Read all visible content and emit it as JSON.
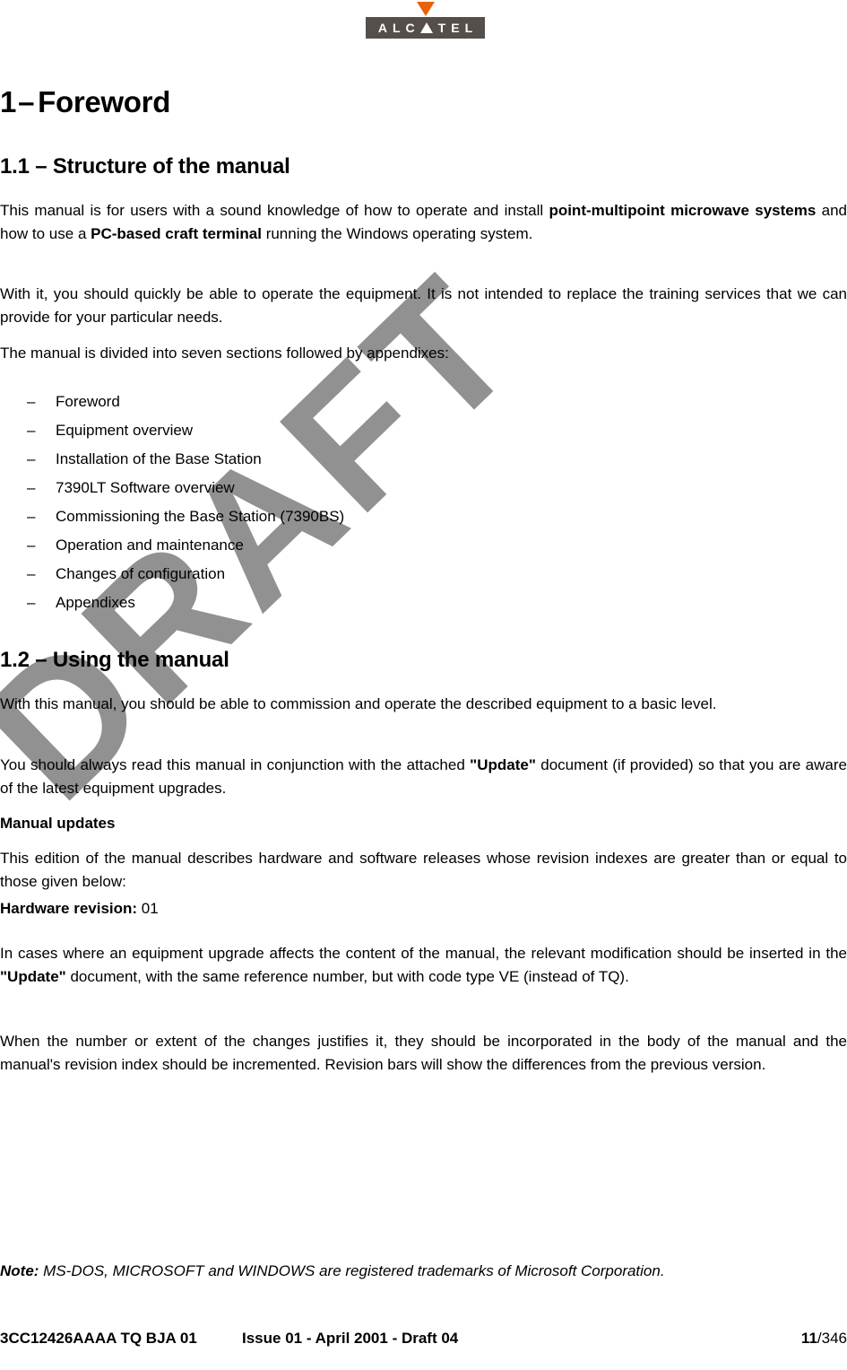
{
  "logo": {
    "name": "alcatel-logo",
    "letters": [
      "A",
      "L",
      "C",
      "A",
      "T",
      "E",
      "L"
    ],
    "box_color": "#554E4A",
    "triangle_color": "#E8620B",
    "letter_color": "#FFFFFF"
  },
  "watermark": {
    "text": "DRAFT",
    "color": "#919191"
  },
  "headings": {
    "chapter_number": "1",
    "chapter_dash": "–",
    "chapter_title": "Foreword",
    "section_1_1": "1.1 –  Structure of the manual",
    "section_1_2": "1.2 –  Using the manual",
    "subheading_manual_updates": "Manual updates"
  },
  "paragraphs": {
    "intro_part1": "This manual is for users with a sound knowledge of how to operate and install ",
    "intro_bold1": "point-multipoint microwave systems",
    "intro_part2": " and how to use a ",
    "intro_bold2": "PC-based craft terminal",
    "intro_part3": " running the Windows operating system.",
    "with_it": "With it, you should quickly be able to operate the equipment. It is not intended to replace the training services that we can provide for your particular needs.",
    "divided_into": "The manual is divided into seven sections followed by appendixes:",
    "using_manual_basic": "With this manual, you should be able to commission and operate the described equipment to a basic level.",
    "always_read_part1": "You should always read this manual in conjunction with the attached ",
    "always_read_bold": "\"Update\"",
    "always_read_part2": " document (if provided) so that you are aware of the latest equipment upgrades.",
    "this_edition": "This edition of the manual describes hardware and software releases whose revision indexes are greater than or equal to those given below:",
    "hardware_revision_label": "Hardware revision:",
    "hardware_revision_value": " 01",
    "in_cases_part1": "In cases where an equipment upgrade affects the content of the manual, the relevant modification should be inserted in the ",
    "in_cases_bold": "\"Update\"",
    "in_cases_part2": " document, with the same reference number, but with code type VE (instead of TQ).",
    "when_number": "When the number or extent of the changes justifies it, they should be incorporated in the body of the manual and the manual's revision index should be incremented. Revision bars will show the differences from the previous version.",
    "note_label": "Note:",
    "note_body": " MS-DOS, MICROSOFT and WINDOWS are registered trademarks of Microsoft Corporation."
  },
  "section_list": {
    "dash": "–",
    "items": [
      "Foreword",
      "Equipment overview",
      "Installation of the Base Station",
      "7390LT Software overview",
      "Commissioning the Base Station (7390BS)",
      "Operation and maintenance",
      "Changes of configuration",
      "Appendixes"
    ]
  },
  "footer": {
    "document_code": "3CC12426AAAA TQ BJA 01",
    "issue_info": "Issue 01 - April 2001 - Draft 04",
    "page_number": "11",
    "page_total": "/346"
  }
}
